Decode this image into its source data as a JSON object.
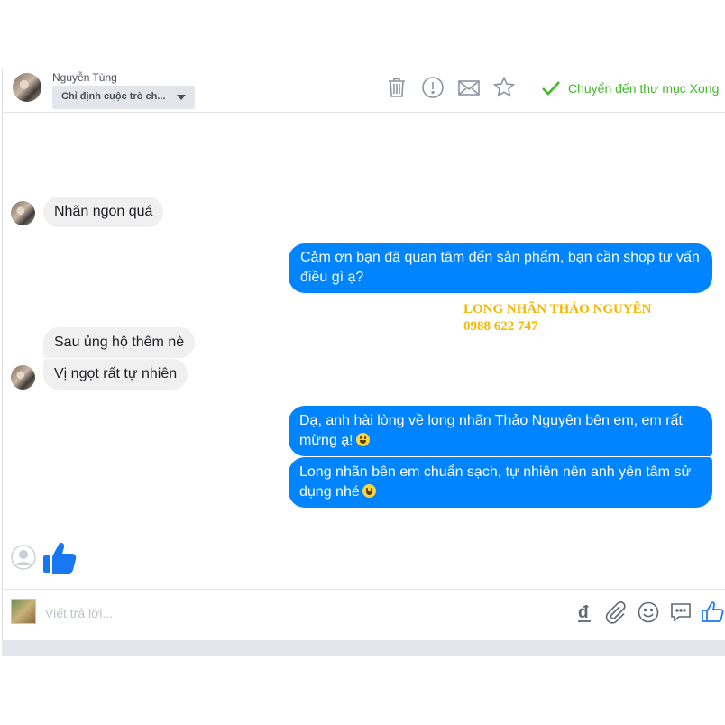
{
  "header": {
    "contact_name": "Nguyễn Tùng",
    "assign_label": "Chỉ định cuộc trò ch...",
    "actions": [
      "trash-icon",
      "report-icon",
      "mail-icon",
      "star-icon"
    ],
    "done_label": "Chuyển đến thư mục Xong"
  },
  "messages": [
    {
      "side": "in",
      "text": "Nhãn ngon quá"
    },
    {
      "side": "out",
      "text": "Cảm ơn bạn đã quan tâm đến sản phẩm, bạn cần shop tư vấn điều gì ạ?"
    },
    {
      "side": "in",
      "text": "Sau ủng hộ thêm nè"
    },
    {
      "side": "in",
      "text": "Vị ngọt rất tự nhiên"
    },
    {
      "side": "out",
      "text": "Dạ, anh hài lòng về long nhãn Thảo Nguyên bên em, em rất mừng ạ!",
      "emoji": "grinning-face"
    },
    {
      "side": "out",
      "text": "Long nhãn bên em chuẩn sạch, tự nhiên nên anh yên tâm sử dụng nhé",
      "emoji": "grinning-face"
    }
  ],
  "watermark": {
    "line1": "LONG NHÃN THẢO NGUYÊN",
    "line2": "0988 622 747"
  },
  "composer": {
    "placeholder": "Viết trả lời..."
  },
  "colors": {
    "outgoing_bubble": "#0084ff",
    "incoming_bubble": "#f0f0f0",
    "done_green": "#42b72a",
    "watermark": "#f5b700"
  }
}
